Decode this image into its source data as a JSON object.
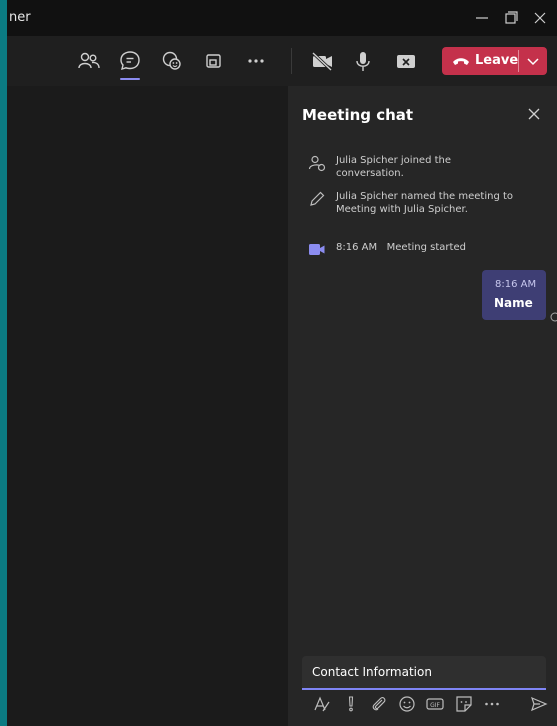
{
  "window": {
    "title": "ner"
  },
  "toolbar": {
    "icons": [
      "people-icon",
      "chat-icon",
      "reactions-icon",
      "share-screen-icon",
      "more-icon",
      "camera-off-icon",
      "mic-icon",
      "share-tray-icon"
    ],
    "leave_label": "Leave"
  },
  "chat": {
    "title": "Meeting chat",
    "events": [
      {
        "icon": "person-joined-icon",
        "text": "Julia Spicher joined the conversation."
      },
      {
        "icon": "pencil-icon",
        "text": "Julia Spicher named the meeting to Meeting with Julia Spicher."
      },
      {
        "icon": "video-icon",
        "time": "8:16 AM",
        "text": "Meeting started"
      }
    ],
    "message": {
      "time": "8:16 AM",
      "text": "Name"
    },
    "composer": {
      "value": "Contact Information"
    }
  },
  "colors": {
    "accent": "#7f85f5",
    "leave": "#c4314b",
    "bubble": "#3e3e74",
    "desktop": "#0b7b82"
  }
}
